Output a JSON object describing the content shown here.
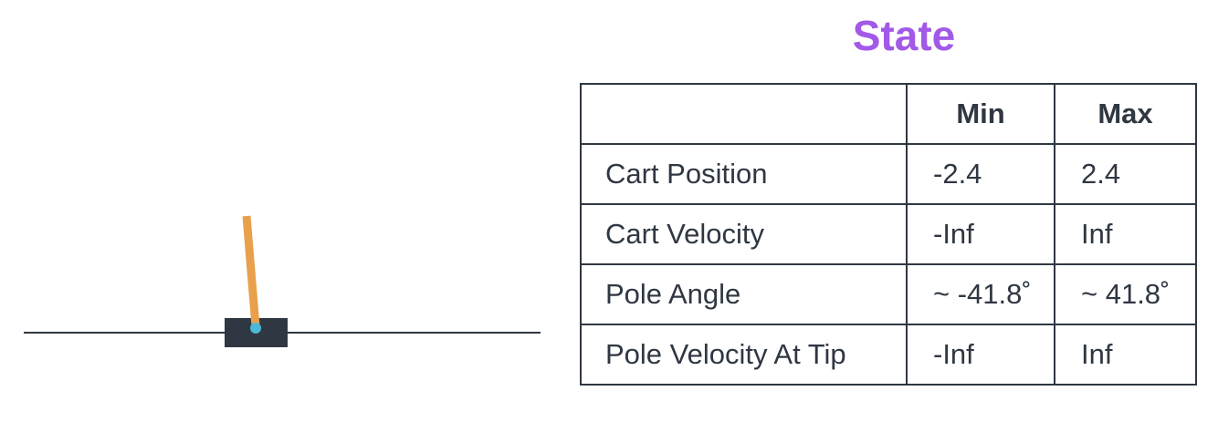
{
  "title": "State",
  "table": {
    "headers": [
      "",
      "Min",
      "Max"
    ],
    "rows": [
      {
        "name": "Cart Position",
        "min": "-2.4",
        "max": "2.4"
      },
      {
        "name": "Cart Velocity",
        "min": "-Inf",
        "max": "Inf"
      },
      {
        "name": "Pole Angle",
        "min": "~ -41.8˚",
        "max": "~ 41.8˚"
      },
      {
        "name": "Pole Velocity At Tip",
        "min": "-Inf",
        "max": "Inf"
      }
    ]
  },
  "colors": {
    "title": "#a259e8",
    "cart": "#2f3742",
    "pole": "#e8a04c",
    "axle": "#4cb8d8",
    "track": "#2f3742"
  }
}
